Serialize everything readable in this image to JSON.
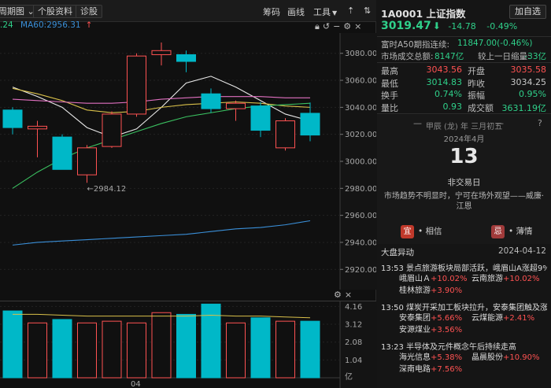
{
  "toolbar": {
    "period_label": "周期图",
    "stock_data_label": "个股资料",
    "diagnose_label": "诊股",
    "chips_label": "筹码",
    "draw_label": "画线",
    "tools_label": "工具"
  },
  "ma_legend": {
    "ma_left_value": ".24",
    "ma60_label": "MA60:2956.31"
  },
  "colors": {
    "up": "#ff5252",
    "down": "#00b8c8",
    "green": "#2fd08a",
    "ma_white": "#e8e8e8",
    "ma_yellow": "#d9c04a",
    "ma_pink": "#e070c0",
    "ma_green": "#3ac060",
    "ma_blue": "#3a8fd8"
  },
  "chart_data": {
    "type": "candlestick",
    "price_axis_ticks": [
      "3080.00",
      "3060.00",
      "3040.00",
      "3020.00",
      "3000.00",
      "2980.00",
      "2960.00",
      "2940.00",
      "2920.00"
    ],
    "ylim": [
      2905,
      3095
    ],
    "low_marker_label": "←2984.12",
    "x_tick_label": "04",
    "candles": [
      {
        "o": 3038,
        "c": 3025,
        "h": 3040,
        "l": 3020
      },
      {
        "o": 3024,
        "c": 3026,
        "h": 3030,
        "l": 3003
      },
      {
        "o": 3018,
        "c": 2994,
        "h": 3020,
        "l": 2994
      },
      {
        "o": 2990,
        "c": 3010,
        "h": 3012,
        "l": 2984.12
      },
      {
        "o": 3011,
        "c": 3035,
        "h": 3037,
        "l": 3010
      },
      {
        "o": 3035,
        "c": 3078,
        "h": 3080,
        "l": 3033
      },
      {
        "o": 3079,
        "c": 3082,
        "h": 3088,
        "l": 3071
      },
      {
        "o": 3079,
        "c": 3074,
        "h": 3082,
        "l": 3066
      },
      {
        "o": 3050,
        "c": 3039,
        "h": 3054,
        "l": 3036
      },
      {
        "o": 3039,
        "c": 3043,
        "h": 3045,
        "l": 3030
      },
      {
        "o": 3041,
        "c": 3023,
        "h": 3044,
        "l": 3018
      },
      {
        "o": 3010,
        "c": 3030,
        "h": 3032,
        "l": 3008
      },
      {
        "o": 3035.58,
        "c": 3019.47,
        "h": 3043.56,
        "l": 3014.83
      }
    ],
    "ma_series": [
      {
        "color_key": "ma_white",
        "values": [
          3055,
          3048,
          3040,
          3025,
          3018,
          3024,
          3040,
          3058,
          3063,
          3055,
          3045,
          3035,
          3030
        ]
      },
      {
        "color_key": "ma_yellow",
        "values": [
          3054,
          3050,
          3045,
          3038,
          3036,
          3037,
          3040,
          3042,
          3043,
          3044,
          3043,
          3041,
          3040
        ]
      },
      {
        "color_key": "ma_pink",
        "values": [
          3046,
          3045,
          3044,
          3043,
          3043,
          3044,
          3046,
          3047,
          3048,
          3048,
          3048,
          3047,
          3047
        ]
      },
      {
        "color_key": "ma_green",
        "values": [
          2980,
          2992,
          3002,
          3010,
          3016,
          3022,
          3028,
          3033,
          3036,
          3039,
          3041,
          3042,
          3043
        ]
      },
      {
        "color_key": "ma_blue",
        "values": [
          2938,
          2940,
          2941,
          2942,
          2943,
          2944,
          2945,
          2946,
          2948,
          2950,
          2951,
          2953,
          2956
        ]
      }
    ],
    "volume": {
      "axis_ticks": [
        "4.16",
        "3.12",
        "2.08",
        "1.04"
      ],
      "unit_label": "亿",
      "ylim": [
        0,
        4.5
      ],
      "values": [
        3.9,
        3.2,
        3.4,
        3.2,
        3.3,
        3.2,
        3.8,
        3.7,
        4.3,
        3.2,
        3.5,
        3.3,
        3.3
      ],
      "ma_line": [
        3.7,
        3.7,
        3.65,
        3.6,
        3.6,
        3.6,
        3.6,
        3.6,
        3.65,
        3.6,
        3.6,
        3.55,
        3.5
      ]
    }
  },
  "panel": {
    "code_name": "1A0001 上证指数",
    "add_self_label": "加自选",
    "price": "3019.47",
    "change": "-14.78",
    "change_pct": "-0.49%",
    "a50_label": "富时A50期指连续:",
    "a50_value": "11847.00(-0.46%)",
    "amount_label": "市场成交总额:",
    "amount_value": "8147亿",
    "amount_cmp_label": "较上一日缩量:",
    "amount_cmp_value": "-33亿",
    "stats": [
      {
        "k1": "最高",
        "v1": "3043.56",
        "c1": "red",
        "k2": "开盘",
        "v2": "3035.58",
        "c2": "red"
      },
      {
        "k1": "最低",
        "v1": "3014.83",
        "c1": "green",
        "k2": "昨收",
        "v2": "3034.25",
        "c2": "plain"
      },
      {
        "k1": "换手",
        "v1": "0.74%",
        "c1": "green",
        "k2": "振幅",
        "v2": "0.95%",
        "c2": "green"
      },
      {
        "k1": "量比",
        "v1": "0.93",
        "c1": "green",
        "k2": "成交额",
        "v2": "3631.19亿",
        "c2": "green"
      }
    ],
    "calendar": {
      "lunar": "甲辰 (龙) 年 三月初五",
      "month": "2024年4月",
      "day": "13",
      "status": "非交易日",
      "quote": "市场趋势不明显时，宁可在场外观望——威廉·江恩",
      "yi_tag": "宜",
      "yi_text": "• 相信",
      "ji_tag": "忌",
      "ji_text": "• 薄情"
    },
    "news_title": "大盘异动",
    "news_date": "2024-04-12",
    "news": [
      {
        "time": "13:53",
        "title": "景点旅游板块局部活跃，峨眉山A涨超9%",
        "stocks": [
          {
            "name": "峨眉山Ａ",
            "pct": "+10.02%"
          },
          {
            "name": "云南旅游",
            "pct": "+10.02%"
          },
          {
            "name": "桂林旅游",
            "pct": "+3.90%"
          }
        ]
      },
      {
        "time": "13:50",
        "title": "煤炭开采加工板块拉升，安泰集团触及涨停",
        "stocks": [
          {
            "name": "安泰集团",
            "pct": "+5.66%"
          },
          {
            "name": "云煤能源",
            "pct": "+2.41%"
          },
          {
            "name": "安源煤业",
            "pct": "+3.56%"
          }
        ]
      },
      {
        "time": "13:23",
        "title": "半导体及元件概念午后持续走高",
        "stocks": [
          {
            "name": "海光信息",
            "pct": "+5.38%"
          },
          {
            "name": "晶晨股份",
            "pct": "+10.90%"
          },
          {
            "name": "深南电路",
            "pct": "+7.56%"
          }
        ]
      }
    ]
  }
}
